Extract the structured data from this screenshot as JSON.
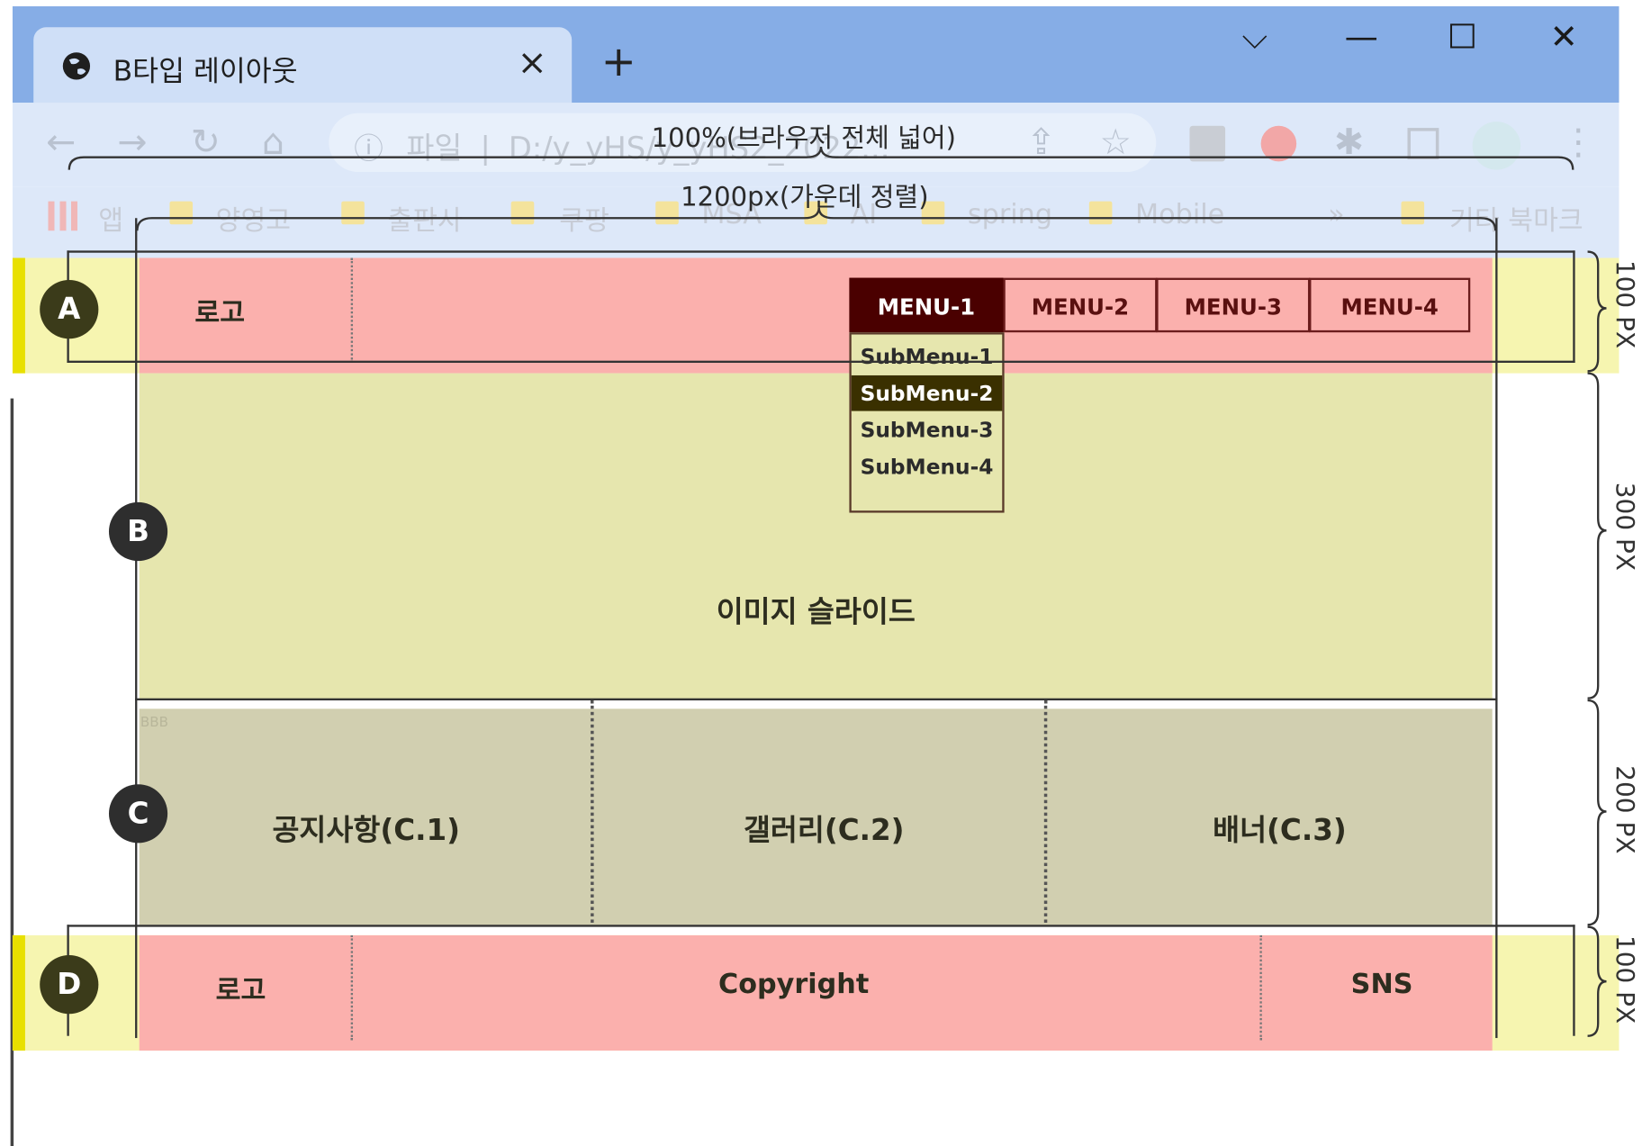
{
  "browser": {
    "tab_title": "B타입 레이아웃",
    "tab_close": "×",
    "new_tab": "+",
    "window_controls": {
      "chevron": "⌵",
      "minimize": "—",
      "maximize": "☐",
      "close": "✕"
    },
    "address_prefix": "파일",
    "address_url": "D:/y_yHS/y_yHS2_2022...",
    "bookmarks": [
      "앱",
      "양영고",
      "출판사",
      "쿠팡",
      "MSA",
      "AI",
      "spring",
      "Mobile",
      "»",
      "기타 북마크"
    ]
  },
  "annotations": {
    "full_width": "100%(브라우저 전체 넓어)",
    "fixed_width": "1200px(가운데 정렬)",
    "height_a": "100 PX",
    "height_b": "300 PX",
    "height_c": "200 PX",
    "height_d": "100 PX",
    "small_text": "BBB"
  },
  "badges": {
    "a": "A",
    "b": "B",
    "c": "C",
    "d": "D"
  },
  "header": {
    "logo": "로고",
    "menus": [
      "MENU-1",
      "MENU-2",
      "MENU-3",
      "MENU-4"
    ],
    "submenus": [
      "SubMenu-1",
      "SubMenu-2",
      "SubMenu-3",
      "SubMenu-4"
    ]
  },
  "slide": {
    "label": "이미지 슬라이드"
  },
  "content": {
    "c1": "공지사항(C.1)",
    "c2": "갤러리(C.2)",
    "c3": "배너(C.3)"
  },
  "footer": {
    "logo": "로고",
    "copyright": "Copyright",
    "sns": "SNS"
  },
  "colors": {
    "header_pink": "#fbb0ad",
    "slide_yellow": "#e6e6ae",
    "content_khaki": "#d1cfb0",
    "menu_active": "#4a0000"
  }
}
